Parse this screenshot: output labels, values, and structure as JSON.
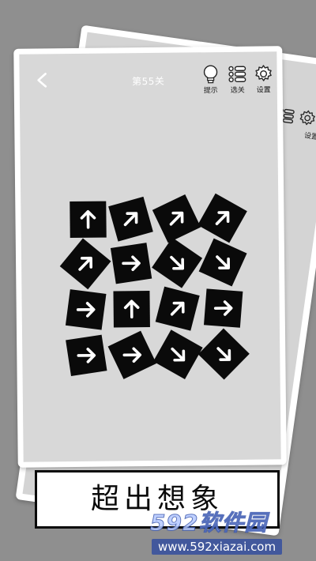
{
  "level": {
    "title": "第55关"
  },
  "toolbar": {
    "hint_label": "提示",
    "levels_label": "选关",
    "settings_label": "设置"
  },
  "back_card": {
    "settings_label": "设置"
  },
  "tiles": [
    {
      "row": 0,
      "col": 0,
      "tilt": 0,
      "arrow": "up"
    },
    {
      "row": 0,
      "col": 1,
      "tilt": -15,
      "arrow": "up-right"
    },
    {
      "row": 0,
      "col": 2,
      "tilt": -25,
      "arrow": "up-right"
    },
    {
      "row": 0,
      "col": 3,
      "tilt": 30,
      "arrow": "up-right"
    },
    {
      "row": 1,
      "col": 0,
      "tilt": 40,
      "arrow": "up-right"
    },
    {
      "row": 1,
      "col": 1,
      "tilt": -8,
      "arrow": "right"
    },
    {
      "row": 1,
      "col": 2,
      "tilt": 35,
      "arrow": "down-right"
    },
    {
      "row": 1,
      "col": 3,
      "tilt": 25,
      "arrow": "down-right"
    },
    {
      "row": 2,
      "col": 0,
      "tilt": 8,
      "arrow": "right"
    },
    {
      "row": 2,
      "col": 1,
      "tilt": 0,
      "arrow": "up"
    },
    {
      "row": 2,
      "col": 2,
      "tilt": 15,
      "arrow": "up-right"
    },
    {
      "row": 2,
      "col": 3,
      "tilt": 5,
      "arrow": "right"
    },
    {
      "row": 3,
      "col": 0,
      "tilt": -8,
      "arrow": "right"
    },
    {
      "row": 3,
      "col": 1,
      "tilt": -25,
      "arrow": "right"
    },
    {
      "row": 3,
      "col": 2,
      "tilt": 30,
      "arrow": "down-right"
    },
    {
      "row": 3,
      "col": 3,
      "tilt": 45,
      "arrow": "down-right"
    }
  ],
  "banner": {
    "text": "超出想象"
  },
  "watermark": {
    "brand": "592软件园",
    "url": "www.592xiazai.com"
  }
}
